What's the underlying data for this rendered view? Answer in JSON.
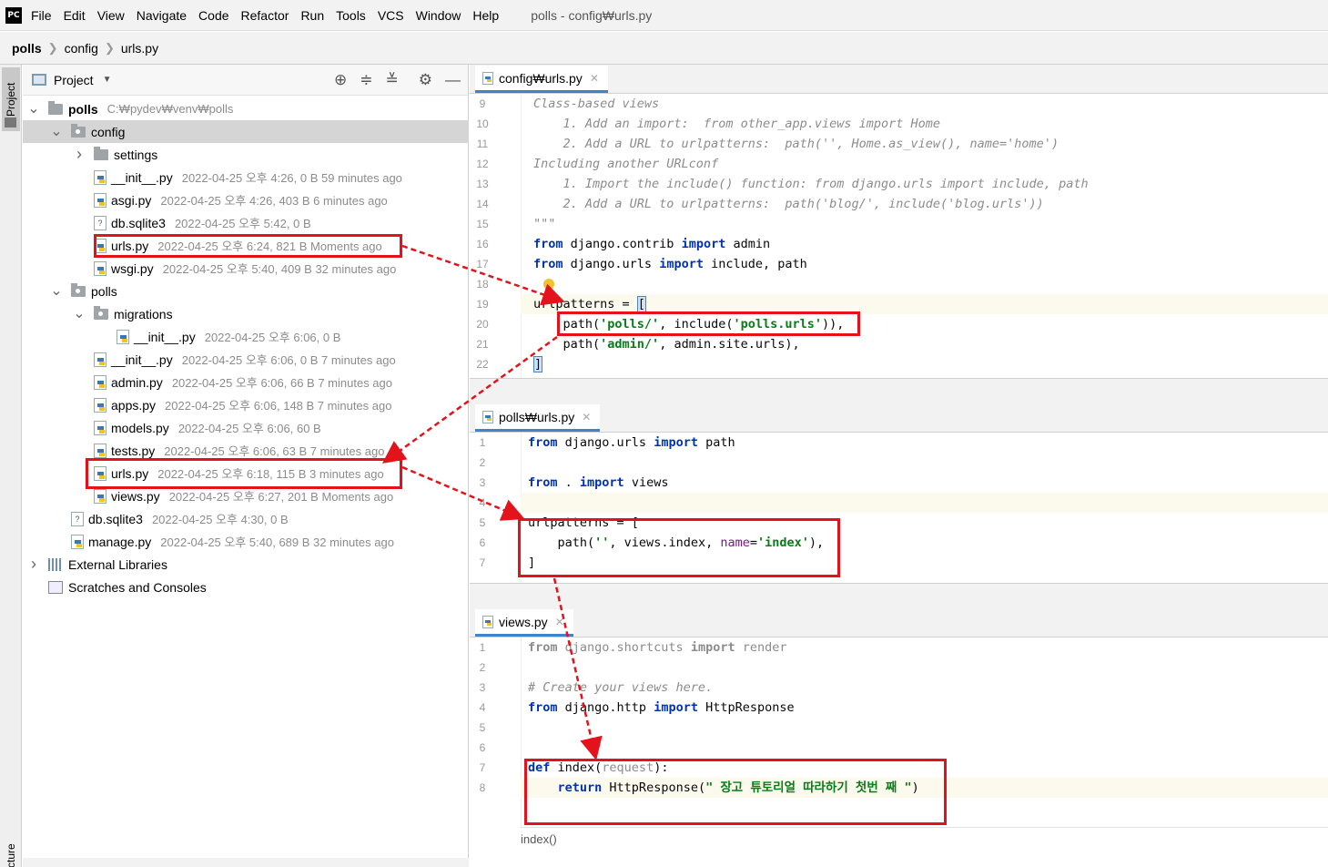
{
  "menubar": {
    "logo": "PC",
    "items": [
      "File",
      "Edit",
      "View",
      "Navigate",
      "Code",
      "Refactor",
      "Run",
      "Tools",
      "VCS",
      "Window",
      "Help"
    ],
    "window_title": "polls - config₩urls.py"
  },
  "navbar": {
    "crumbs": [
      "polls",
      "config",
      "urls.py"
    ]
  },
  "leftbar": {
    "project_tab": "Project",
    "structure_tab": "Structure"
  },
  "project_panel": {
    "title": "Project",
    "tree": [
      {
        "name": "polls",
        "meta": "C:₩pydev₩venv₩polls",
        "type": "folder",
        "arrow": "down",
        "indent": 0,
        "bold": true
      },
      {
        "name": "config",
        "meta": "",
        "type": "pkg",
        "arrow": "down",
        "indent": 1,
        "selected": true
      },
      {
        "name": "settings",
        "meta": "",
        "type": "folder",
        "arrow": "right",
        "indent": 2
      },
      {
        "name": "__init__.py",
        "meta": "2022-04-25 오후 4:26, 0 B 59 minutes ago",
        "type": "py",
        "indent": 2
      },
      {
        "name": "asgi.py",
        "meta": "2022-04-25 오후 4:26, 403 B 6 minutes ago",
        "type": "py",
        "indent": 2
      },
      {
        "name": "db.sqlite3",
        "meta": "2022-04-25 오후 5:42, 0 B",
        "type": "db",
        "indent": 2
      },
      {
        "name": "urls.py",
        "meta": "2022-04-25 오후 6:24, 821 B Moments ago",
        "type": "py",
        "indent": 2
      },
      {
        "name": "wsgi.py",
        "meta": "2022-04-25 오후 5:40, 409 B 32 minutes ago",
        "type": "py",
        "indent": 2
      },
      {
        "name": "polls",
        "meta": "",
        "type": "pkg",
        "arrow": "down",
        "indent": 1
      },
      {
        "name": "migrations",
        "meta": "",
        "type": "pkg",
        "arrow": "down",
        "indent": 2
      },
      {
        "name": "__init__.py",
        "meta": "2022-04-25 오후 6:06, 0 B",
        "type": "py",
        "indent": 3
      },
      {
        "name": "__init__.py",
        "meta": "2022-04-25 오후 6:06, 0 B 7 minutes ago",
        "type": "py",
        "indent": 2
      },
      {
        "name": "admin.py",
        "meta": "2022-04-25 오후 6:06, 66 B 7 minutes ago",
        "type": "py",
        "indent": 2
      },
      {
        "name": "apps.py",
        "meta": "2022-04-25 오후 6:06, 148 B 7 minutes ago",
        "type": "py",
        "indent": 2
      },
      {
        "name": "models.py",
        "meta": "2022-04-25 오후 6:06, 60 B",
        "type": "py",
        "indent": 2
      },
      {
        "name": "tests.py",
        "meta": "2022-04-25 오후 6:06, 63 B 7 minutes ago",
        "type": "py",
        "indent": 2
      },
      {
        "name": "urls.py",
        "meta": "2022-04-25 오후 6:18, 115 B 3 minutes ago",
        "type": "py",
        "indent": 2
      },
      {
        "name": "views.py",
        "meta": "2022-04-25 오후 6:27, 201 B Moments ago",
        "type": "py",
        "indent": 2
      },
      {
        "name": "db.sqlite3",
        "meta": "2022-04-25 오후 4:30, 0 B",
        "type": "db",
        "indent": 1
      },
      {
        "name": "manage.py",
        "meta": "2022-04-25 오후 5:40, 689 B 32 minutes ago",
        "type": "py",
        "indent": 1
      },
      {
        "name": "External Libraries",
        "meta": "",
        "type": "lib",
        "arrow": "right",
        "indent": 0
      },
      {
        "name": "Scratches and Consoles",
        "meta": "",
        "type": "scratch",
        "indent": 0
      }
    ]
  },
  "editors": [
    {
      "tab": "config₩urls.py",
      "lines": [
        {
          "n": "9",
          "html": "<span class=\"cm\">Class-based views</span>"
        },
        {
          "n": "10",
          "html": "<span class=\"cm\">    1. Add an import:  from other_app.views import Home</span>"
        },
        {
          "n": "11",
          "html": "<span class=\"cm\">    2. Add a URL to urlpatterns:  path('', Home.as_view(), name='home')</span>"
        },
        {
          "n": "12",
          "html": "<span class=\"cm\">Including another URLconf</span>"
        },
        {
          "n": "13",
          "html": "<span class=\"cm\">    1. Import the include() function: from django.urls import include, path</span>"
        },
        {
          "n": "14",
          "html": "<span class=\"cm\">    2. Add a URL to urlpatterns:  path('blog/', include('blog.urls'))</span>"
        },
        {
          "n": "15",
          "html": "<span class=\"cm\">\"\"\"</span>"
        },
        {
          "n": "16",
          "html": "<span class=\"kw\">from</span> django.contrib <span class=\"kw\">import</span> admin"
        },
        {
          "n": "17",
          "html": "<span class=\"kw\">from</span> django.urls <span class=\"kw\">import</span> include, path"
        },
        {
          "n": "18",
          "html": ""
        },
        {
          "n": "19",
          "html": "urlpatterns = <span class=\"caret\">[</span>"
        },
        {
          "n": "20",
          "html": "    path(<span class=\"st\">'polls/'</span>, include(<span class=\"st\">'polls.urls'</span>)),"
        },
        {
          "n": "21",
          "html": "    path(<span class=\"st\">'admin/'</span>, admin.site.urls),"
        },
        {
          "n": "22",
          "html": "<span class=\"caret\">]</span>"
        }
      ]
    },
    {
      "tab": "polls₩urls.py",
      "lines": [
        {
          "n": "1",
          "html": "<span class=\"kw\">from</span> django.urls <span class=\"kw\">import</span> path"
        },
        {
          "n": "2",
          "html": ""
        },
        {
          "n": "3",
          "html": "<span class=\"kw\">from</span> . <span class=\"kw\">import</span> views"
        },
        {
          "n": "4",
          "html": ""
        },
        {
          "n": "5",
          "html": "urlpatterns = ["
        },
        {
          "n": "6",
          "html": "    path(<span class=\"st\">''</span>, views.index, <span class=\"pm\">name</span>=<span class=\"st\">'index'</span>),"
        },
        {
          "n": "7",
          "html": "]"
        }
      ]
    },
    {
      "tab": "views.py",
      "lines": [
        {
          "n": "1",
          "html": "<span class=\"gr\"><b>from</b> django.shortcuts <b>import</b> render</span>"
        },
        {
          "n": "2",
          "html": ""
        },
        {
          "n": "3",
          "html": "<span class=\"cm\"># Create your views here.</span>"
        },
        {
          "n": "4",
          "html": "<span class=\"kw\">from</span> django.http <span class=\"kw\">import</span> HttpResponse"
        },
        {
          "n": "5",
          "html": ""
        },
        {
          "n": "6",
          "html": ""
        },
        {
          "n": "7",
          "html": "<span class=\"kw\">def</span> index(<span class=\"gr\">request</span>):"
        },
        {
          "n": "8",
          "html": "    <span class=\"kw\">return</span> HttpResponse(<span class=\"st\">\" 장고 튜토리얼 따라하기 첫번 째 \"</span>)"
        }
      ],
      "footer": "index()"
    }
  ],
  "colors": {
    "annotation_red": "#e3121b",
    "keyword": "#0033b3",
    "string": "#067d17",
    "comment": "#8c8c8c",
    "tab_accent": "#4083c9"
  }
}
